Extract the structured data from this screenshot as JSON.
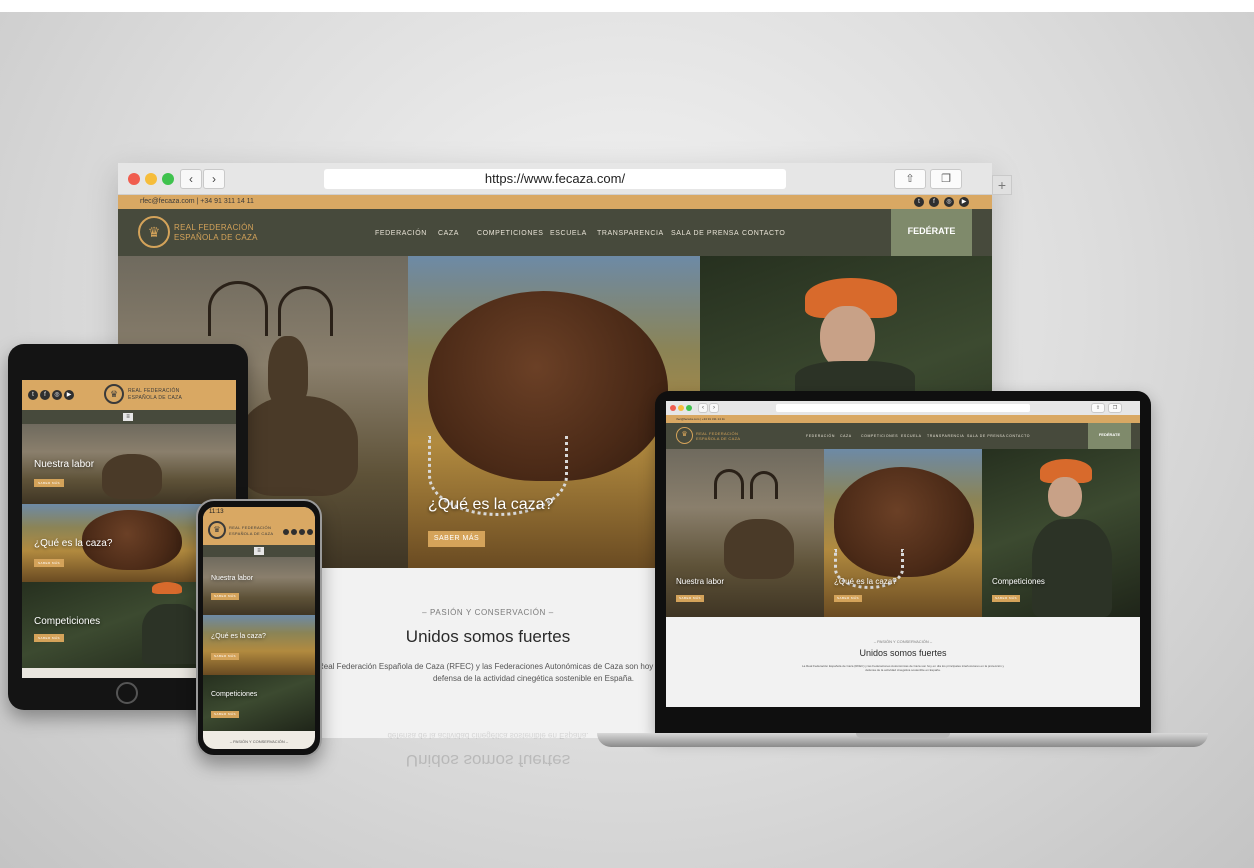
{
  "browser": {
    "url": "https://www.fecaza.com/",
    "nav_back": "‹",
    "nav_forward": "›",
    "share_icon": "⇧",
    "tabs_icon": "❐",
    "new_tab": "+"
  },
  "site": {
    "contact_info": "rfec@fecaza.com | +34 91 311 14 11",
    "logo_line1": "REAL FEDERACIÓN",
    "logo_line2": "ESPAÑOLA DE CAZA",
    "menu": [
      "FEDERACIÓN",
      "CAZA",
      "COMPETICIONES",
      "ESCUELA",
      "TRANSPARENCIA",
      "SALA DE PRENSA",
      "CONTACTO"
    ],
    "cta": "FEDÉRATE",
    "social_icons": [
      "twitter-icon",
      "facebook-icon",
      "instagram-icon",
      "youtube-icon"
    ]
  },
  "hero": {
    "panel1_title": "Nuestra labor",
    "panel2_title": "¿Qué es la caza?",
    "panel3_title": "Competiciones",
    "button": "SABER MÁS"
  },
  "section": {
    "kicker": "– PASIÓN Y CONSERVACIÓN –",
    "title": "Unidos somos fuertes",
    "text_line1": "Real Federación Española de Caza (RFEC) y las Federaciones Autonómicas de Caza son hoy en día los p",
    "text_line2": "defensa de la actividad cinegética sostenible en España."
  },
  "phone": {
    "time": "11:13",
    "kicker": "– PASIÓN Y CONSERVACIÓN –"
  },
  "laptop": {
    "text_line1": "La Real Federación Española de Caza (RFEC) y las Federaciones Autonómicas de Caza son hoy en día los principales interlocutores en la protección y",
    "text_line2": "defensa de la actividad cinegética sostenible en España."
  },
  "colors": {
    "accent_gold": "#d4a35a",
    "nav_green": "#474a3c",
    "cta_green": "#7f8a6b",
    "info_bar": "#d9a863"
  }
}
